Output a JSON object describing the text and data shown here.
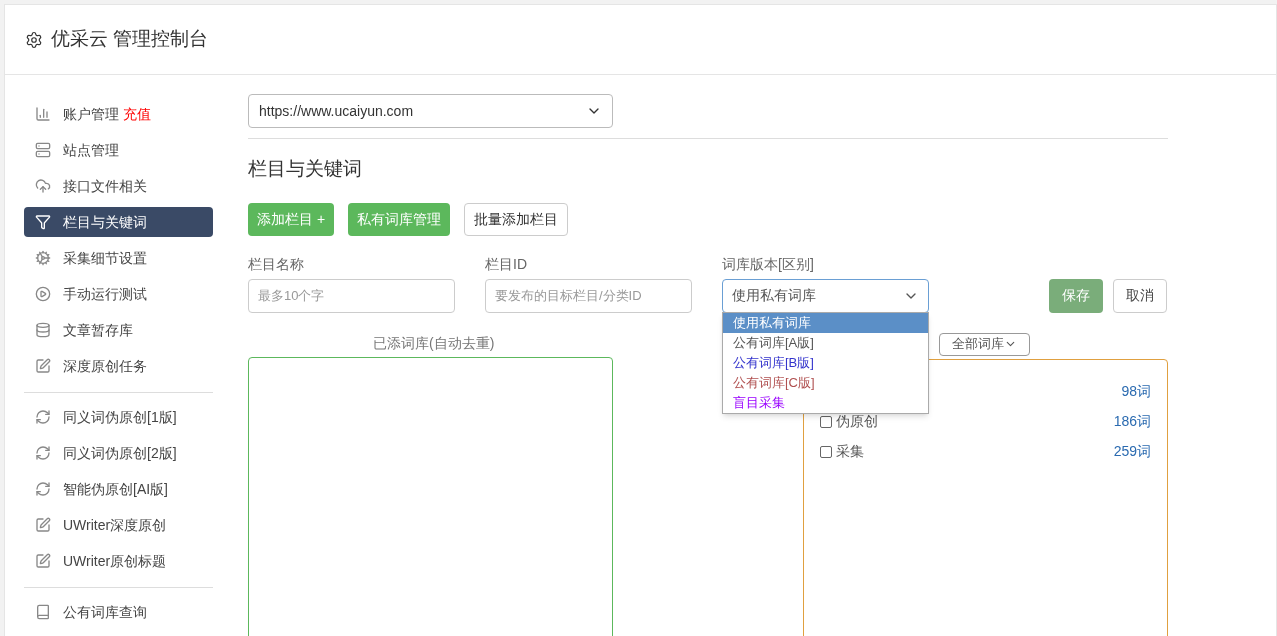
{
  "header": {
    "title": "优采云 管理控制台"
  },
  "sidebar": {
    "groups": [
      [
        {
          "label": "账户管理",
          "badge": "充值",
          "selected": false
        },
        {
          "label": "站点管理",
          "selected": false
        },
        {
          "label": "接口文件相关",
          "selected": false
        },
        {
          "label": "栏目与关键词",
          "selected": true
        },
        {
          "label": "采集细节设置",
          "selected": false
        },
        {
          "label": "手动运行测试",
          "selected": false
        },
        {
          "label": "文章暂存库",
          "selected": false
        },
        {
          "label": "深度原创任务",
          "selected": false
        }
      ],
      [
        {
          "label": "同义词伪原创[1版]",
          "selected": false
        },
        {
          "label": "同义词伪原创[2版]",
          "selected": false
        },
        {
          "label": "智能伪原创[AI版]",
          "selected": false
        },
        {
          "label": "UWriter深度原创",
          "selected": false
        },
        {
          "label": "UWriter原创标题",
          "selected": false
        }
      ],
      [
        {
          "label": "公有词库查询",
          "selected": false
        }
      ]
    ]
  },
  "site_select": {
    "value": "https://www.ucaiyun.com"
  },
  "section_title": "栏目与关键词",
  "buttons": [
    {
      "label": "添加栏目 +",
      "kind": "green"
    },
    {
      "label": "私有词库管理",
      "kind": "green"
    },
    {
      "label": "批量添加栏目",
      "kind": "outline"
    }
  ],
  "form": {
    "name": {
      "label": "栏目名称",
      "placeholder": "最多10个字"
    },
    "id": {
      "label": "栏目ID",
      "placeholder": "要发布的目标栏目/分类ID"
    },
    "version": {
      "label": "词库版本[区别]",
      "value": "使用私有词库",
      "options": [
        {
          "label": "使用私有词库",
          "selected": true
        },
        {
          "label": "公有词库[A版]",
          "selected": false
        },
        {
          "label": "公有词库[B版]",
          "selected": false
        },
        {
          "label": "公有词库[C版]",
          "selected": false
        },
        {
          "label": "盲目采集",
          "selected": false
        }
      ]
    },
    "save": "保存",
    "cancel": "取消"
  },
  "added_label": "已添词库(自动去重)",
  "filter_select": {
    "value": "全部词库"
  },
  "libraries": [
    {
      "count": "98词"
    },
    {
      "label": "伪原创",
      "count": "186词",
      "checked": false
    },
    {
      "label": "采集",
      "count": "259词",
      "checked": false
    }
  ]
}
